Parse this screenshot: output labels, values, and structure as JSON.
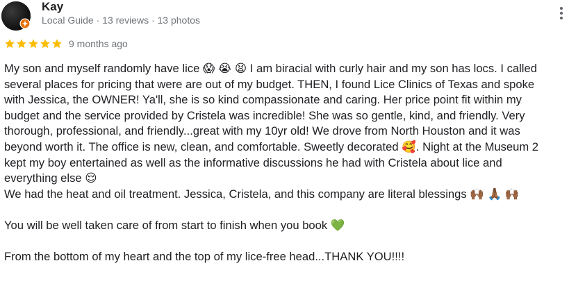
{
  "reviewer": {
    "name": "Kay",
    "meta": "Local Guide · 13 reviews · 13 photos"
  },
  "rating": {
    "stars": 5,
    "max_stars": 5,
    "date": "9 months ago"
  },
  "review": {
    "lines": [
      [
        "My son and myself randomly have lice ",
        "😱",
        " ",
        "😭",
        " ",
        "😫",
        "  I am biracial with curly hair and my son has locs. I called"
      ],
      "several places for pricing that were are out of my budget. THEN, I found Lice Clinics of Texas and spoke",
      "with Jessica, the OWNER! Ya'll, she is so kind compassionate and caring. Her price point fit within my",
      "budget and the service provided by Cristela was incredible! She was so gentle, kind, and friendly. Very",
      "thorough, professional, and friendly...great with my 10yr old! We drove from North Houston and it was",
      [
        "beyond worth it. The office is new, clean, and comfortable. Sweetly decorated ",
        "🥰",
        ". Night at the Museum 2"
      ],
      "kept my boy entertained as well as the informative discussions he had with Cristela about lice and",
      [
        "everything else ",
        "😌"
      ],
      [
        "We had the heat and oil treatment. Jessica, Cristela, and this company are literal blessings ",
        "🙌🏾",
        "  ",
        "🙏🏾",
        " ",
        "🙌🏾"
      ],
      "",
      [
        "You will be well taken care of from start to finish when you book ",
        "💚"
      ],
      "",
      "From the bottom of my heart and the top of my lice-free head...THANK YOU!!!!"
    ]
  },
  "icons": {
    "avatar": "avatar",
    "badge": "local-guide-badge-icon",
    "menu": "more-vertical-icon",
    "star": "star-icon"
  },
  "colors": {
    "star": "#fbbc04",
    "badge": "#e8710a",
    "meta": "#70757a",
    "text": "#202124"
  }
}
